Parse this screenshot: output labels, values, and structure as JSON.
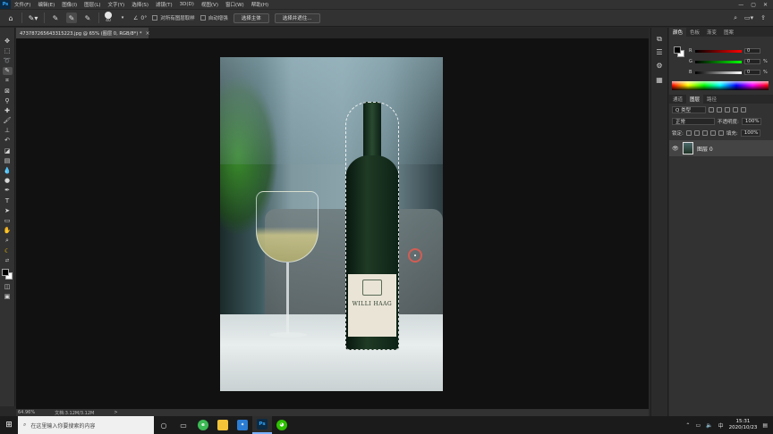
{
  "app": {
    "logo": "Ps",
    "menu": [
      "文件(F)",
      "编辑(E)",
      "图像(I)",
      "图层(L)",
      "文字(Y)",
      "选择(S)",
      "滤镜(T)",
      "3D(D)",
      "视图(V)",
      "窗口(W)",
      "帮助(H)"
    ],
    "window_controls": [
      "—",
      "▢",
      "✕"
    ]
  },
  "options": {
    "brush_size": "40",
    "angle": "0°",
    "sample_all_layers": "对所有图层取样",
    "auto_enhance": "自动增强",
    "select_subject": "选择主体",
    "select_and_mask": "选择并遮住..."
  },
  "document": {
    "tab_title": "473787265643315223.jpg @ 65% (图层 0, RGB/8*) *",
    "close_glyph": "×",
    "label_text": "WILLI HAAG"
  },
  "status": {
    "zoom": "64.96%",
    "doc_size": "文档:3.12M/3.12M",
    "arrow": ">"
  },
  "color_panel": {
    "tabs": [
      "颜色",
      "色板",
      "渐变",
      "图案"
    ],
    "channels": [
      {
        "label": "R",
        "value": "0"
      },
      {
        "label": "G",
        "value": "0"
      },
      {
        "label": "B",
        "value": "0"
      }
    ],
    "pct": "%"
  },
  "layers_panel": {
    "tabs": [
      "通道",
      "图层",
      "路径"
    ],
    "filter_kind": "Q 类型",
    "blend_mode": "正常",
    "opacity_label": "不透明度:",
    "opacity_value": "100%",
    "lock_label": "锁定:",
    "fill_label": "填充:",
    "fill_value": "100%",
    "layer_name": "图层 0",
    "eye": "👁"
  },
  "taskbar": {
    "search_placeholder": "在这里输入你要搜索的内容",
    "time": "15:31",
    "date": "2020/10/23",
    "ime": "中",
    "ps_label": "Ps"
  }
}
